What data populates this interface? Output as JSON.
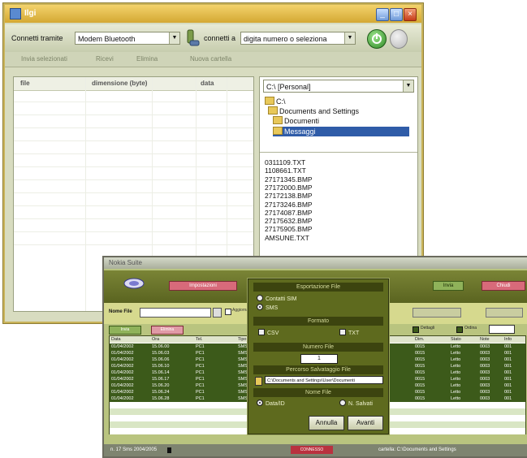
{
  "back_window": {
    "title": "Ilgi",
    "toolbar": {
      "connect_via_label": "Connetti tramite",
      "device_value": "Modem Bluetooth",
      "connect_to_label": "connetti a",
      "number_value": "digita numero o seleziona"
    },
    "secondary_toolbar": [
      "Invia selezionati",
      "Ricevi",
      "Elimina",
      "Nuova cartella"
    ],
    "table_columns": [
      "file",
      "dimensione (byte)",
      "data"
    ],
    "drive_value": "C:\\ [Personal]",
    "tree": [
      "C:\\",
      "Documents and Settings",
      "Documenti",
      "Messaggi"
    ],
    "files": [
      "0311109.TXT",
      "1108661.TXT",
      "27171345.BMP",
      "27172000.BMP",
      "27172138.BMP",
      "27173246.BMP",
      "27174087.BMP",
      "27175632.BMP",
      "27175905.BMP",
      "AMSUNE.TXT"
    ]
  },
  "front_window": {
    "title": "Nokia Suite",
    "header_buttons": [
      "Impostazioni",
      "Invia",
      "Chiudi"
    ],
    "search_label": "Nome File",
    "row_controls": [
      "Aggiorna",
      "Sfoglia"
    ],
    "sub_buttons": [
      "Invia",
      "Elimina"
    ],
    "right_controls": [
      "Dettagli",
      "Ordina"
    ],
    "table_columns": [
      "Data",
      "Ora",
      "Tel.",
      "Tipo",
      "Dim.",
      "Stato",
      "Note",
      "Info"
    ],
    "rows": [
      [
        "01/04/2002",
        "15.06.00",
        "PC1",
        "SMS",
        "0015",
        "Letto",
        "0003",
        "001"
      ],
      [
        "01/04/2002",
        "15.06.03",
        "PC1",
        "SMS",
        "0015",
        "Letto",
        "0003",
        "001"
      ],
      [
        "01/04/2002",
        "15.06.06",
        "PC1",
        "SMS",
        "0015",
        "Letto",
        "0003",
        "001"
      ],
      [
        "01/04/2002",
        "15.06.10",
        "PC1",
        "SMS",
        "0015",
        "Letto",
        "0003",
        "001"
      ],
      [
        "01/04/2002",
        "15.06.14",
        "PC1",
        "SMS",
        "0015",
        "Letto",
        "0003",
        "001"
      ],
      [
        "01/04/2002",
        "15.06.17",
        "PC1",
        "SMS",
        "0015",
        "Letto",
        "0003",
        "001"
      ],
      [
        "01/04/2002",
        "15.06.20",
        "PC1",
        "SMS",
        "0015",
        "Letto",
        "0003",
        "001"
      ],
      [
        "01/04/2002",
        "15.06.24",
        "PC1",
        "SMS",
        "0015",
        "Letto",
        "0003",
        "001"
      ],
      [
        "01/04/2002",
        "15.06.28",
        "PC1",
        "SMS",
        "0015",
        "Letto",
        "0003",
        "001"
      ]
    ],
    "status_left": "n. 17 Sms 2004/2005",
    "status_mid": "CONNESSO",
    "status_right": "cartella: C:\\Documents and Settings"
  },
  "dialog": {
    "section_esporta": "Esportazione File",
    "option_contatti": "Contatti SIM",
    "option_sms": "SMS",
    "section_formato": "Formato",
    "option_csv": "CSV",
    "option_txt": "TXT",
    "section_numero": "Numero File",
    "numero_value": "1",
    "section_percorso": "Percorso Salvataggio File",
    "percorso_value": "C:\\Documents and Settings\\User\\Documenti",
    "section_nome": "Nome File",
    "option_data": "Data/ID",
    "option_numero": "N. Salvati",
    "annulla_label": "Annulla",
    "avanti_label": "Avanti"
  }
}
